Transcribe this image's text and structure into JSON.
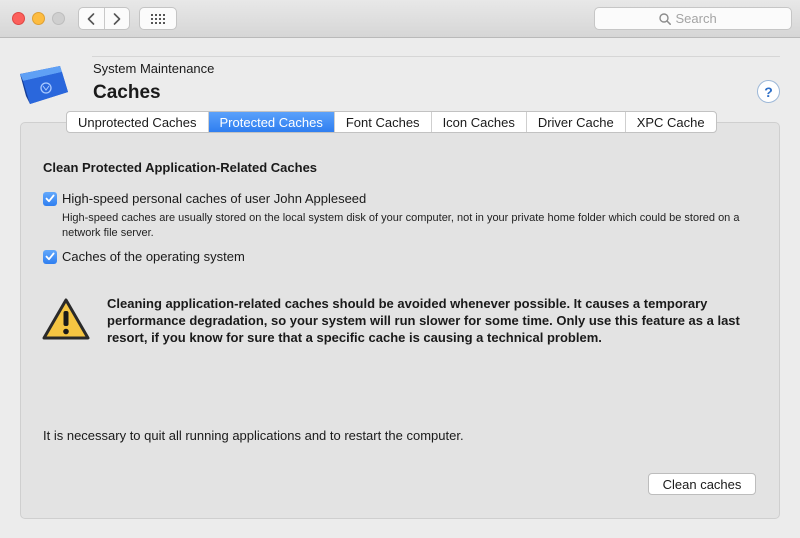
{
  "toolbar": {
    "search_placeholder": "Search"
  },
  "header": {
    "section": "System Maintenance",
    "title": "Caches",
    "help_label": "?"
  },
  "tabs": [
    {
      "label": "Unprotected Caches",
      "active": false
    },
    {
      "label": "Protected Caches",
      "active": true
    },
    {
      "label": "Font Caches",
      "active": false
    },
    {
      "label": "Icon Caches",
      "active": false
    },
    {
      "label": "Driver Cache",
      "active": false
    },
    {
      "label": "XPC Cache",
      "active": false
    }
  ],
  "content": {
    "section_title": "Clean Protected Application-Related Caches",
    "option_personal": {
      "label": "High-speed personal caches of user John Appleseed",
      "checked": true,
      "description": "High-speed caches are usually stored on the local system disk of your computer, not in your private home folder which could be stored on a network file server."
    },
    "option_os": {
      "label": "Caches of the operating system",
      "checked": true
    },
    "warning": "Cleaning application-related caches should be avoided whenever possible. It causes a temporary performance degradation, so your system will run slower for some time. Only use this feature as a last resort, if you know for sure that a specific cache is causing a technical problem.",
    "quit_note": "It is necessary to quit all running applications and to restart the computer.",
    "clean_button": "Clean caches"
  },
  "colors": {
    "accent": "#2f7ef0",
    "warning_fill": "#f5c542",
    "close": "#fc605c",
    "minimize": "#fdbc40"
  },
  "icons": [
    "back-icon",
    "forward-icon",
    "grid-icon",
    "search-icon",
    "trash-bin-icon",
    "help-icon",
    "checkmark-icon",
    "warning-icon"
  ]
}
